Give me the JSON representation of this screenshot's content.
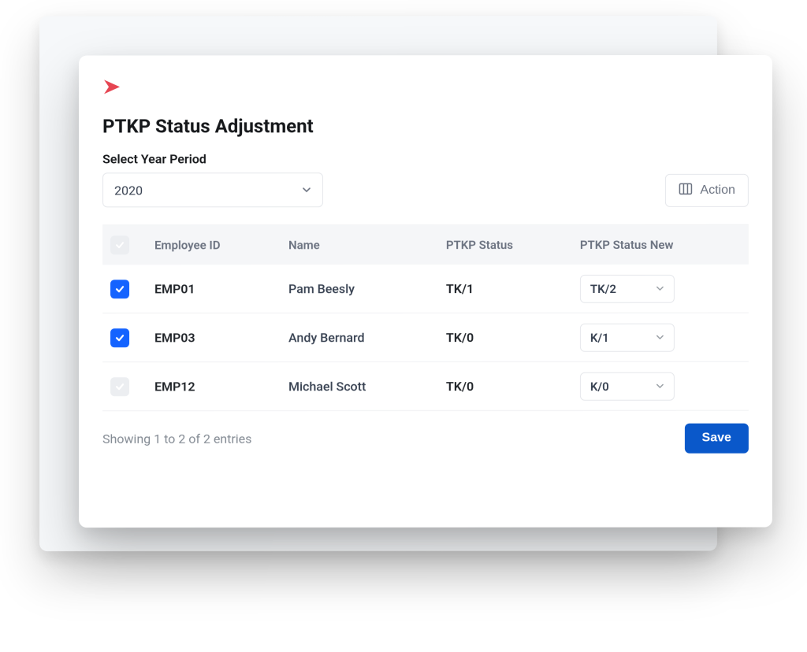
{
  "page": {
    "title": "PTKP Status Adjustment"
  },
  "year": {
    "label": "Select Year Period",
    "value": "2020"
  },
  "action_button": {
    "label": "Action"
  },
  "table": {
    "headers": {
      "employee_id": "Employee ID",
      "name": "Name",
      "ptkp_status": "PTKP Status",
      "ptkp_status_new": "PTKP Status New"
    },
    "rows": [
      {
        "checked": true,
        "employee_id": "EMP01",
        "name": "Pam Beesly",
        "ptkp_status": "TK/1",
        "ptkp_status_new": "TK/2"
      },
      {
        "checked": true,
        "employee_id": "EMP03",
        "name": "Andy Bernard",
        "ptkp_status": "TK/0",
        "ptkp_status_new": "K/1"
      },
      {
        "checked": false,
        "employee_id": "EMP12",
        "name": "Michael Scott",
        "ptkp_status": "TK/0",
        "ptkp_status_new": "K/0"
      }
    ]
  },
  "footer": {
    "entries_text": "Showing 1 to 2 of 2 entries",
    "save_label": "Save"
  }
}
